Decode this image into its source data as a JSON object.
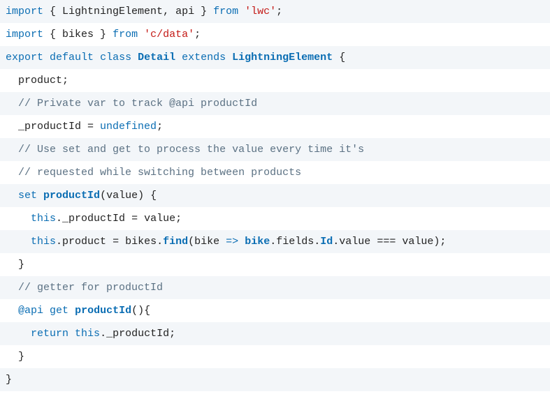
{
  "code": {
    "lines": [
      {
        "indent": 0,
        "tokens": [
          {
            "cls": "tk-keyword",
            "t": "import"
          },
          {
            "cls": "tk-punct",
            "t": " { "
          },
          {
            "cls": "tk-plain",
            "t": "LightningElement"
          },
          {
            "cls": "tk-punct",
            "t": ", "
          },
          {
            "cls": "tk-plain",
            "t": "api"
          },
          {
            "cls": "tk-punct",
            "t": " } "
          },
          {
            "cls": "tk-keyword",
            "t": "from"
          },
          {
            "cls": "tk-punct",
            "t": " "
          },
          {
            "cls": "tk-string",
            "t": "'lwc'"
          },
          {
            "cls": "tk-punct",
            "t": ";"
          }
        ]
      },
      {
        "indent": 0,
        "tokens": [
          {
            "cls": "tk-keyword",
            "t": "import"
          },
          {
            "cls": "tk-punct",
            "t": " { "
          },
          {
            "cls": "tk-plain",
            "t": "bikes"
          },
          {
            "cls": "tk-punct",
            "t": " } "
          },
          {
            "cls": "tk-keyword",
            "t": "from"
          },
          {
            "cls": "tk-punct",
            "t": " "
          },
          {
            "cls": "tk-string",
            "t": "'c/data'"
          },
          {
            "cls": "tk-punct",
            "t": ";"
          }
        ]
      },
      {
        "indent": 0,
        "tokens": [
          {
            "cls": "tk-keyword",
            "t": "export"
          },
          {
            "cls": "tk-punct",
            "t": " "
          },
          {
            "cls": "tk-keyword",
            "t": "default"
          },
          {
            "cls": "tk-punct",
            "t": " "
          },
          {
            "cls": "tk-keyword",
            "t": "class"
          },
          {
            "cls": "tk-punct",
            "t": " "
          },
          {
            "cls": "tk-def",
            "t": "Detail"
          },
          {
            "cls": "tk-punct",
            "t": " "
          },
          {
            "cls": "tk-keyword",
            "t": "extends"
          },
          {
            "cls": "tk-punct",
            "t": " "
          },
          {
            "cls": "tk-def",
            "t": "LightningElement"
          },
          {
            "cls": "tk-punct",
            "t": " {"
          }
        ]
      },
      {
        "indent": 1,
        "tokens": [
          {
            "cls": "tk-plain",
            "t": "product"
          },
          {
            "cls": "tk-punct",
            "t": ";"
          }
        ]
      },
      {
        "indent": 1,
        "tokens": [
          {
            "cls": "tk-comment",
            "t": "// Private var to track @api productId"
          }
        ]
      },
      {
        "indent": 1,
        "tokens": [
          {
            "cls": "tk-plain",
            "t": "_productId"
          },
          {
            "cls": "tk-punct",
            "t": " = "
          },
          {
            "cls": "tk-keyword",
            "t": "undefined"
          },
          {
            "cls": "tk-punct",
            "t": ";"
          }
        ]
      },
      {
        "indent": 1,
        "tokens": [
          {
            "cls": "tk-comment",
            "t": "// Use set and get to process the value every time it's"
          }
        ]
      },
      {
        "indent": 1,
        "tokens": [
          {
            "cls": "tk-comment",
            "t": "// requested while switching between products"
          }
        ]
      },
      {
        "indent": 1,
        "tokens": [
          {
            "cls": "tk-keyword",
            "t": "set"
          },
          {
            "cls": "tk-punct",
            "t": " "
          },
          {
            "cls": "tk-def",
            "t": "productId"
          },
          {
            "cls": "tk-punct",
            "t": "("
          },
          {
            "cls": "tk-plain",
            "t": "value"
          },
          {
            "cls": "tk-punct",
            "t": ") {"
          }
        ]
      },
      {
        "indent": 2,
        "tokens": [
          {
            "cls": "tk-keyword",
            "t": "this"
          },
          {
            "cls": "tk-punct",
            "t": "."
          },
          {
            "cls": "tk-plain",
            "t": "_productId"
          },
          {
            "cls": "tk-punct",
            "t": " = "
          },
          {
            "cls": "tk-plain",
            "t": "value"
          },
          {
            "cls": "tk-punct",
            "t": ";"
          }
        ]
      },
      {
        "indent": 2,
        "tokens": [
          {
            "cls": "tk-keyword",
            "t": "this"
          },
          {
            "cls": "tk-punct",
            "t": "."
          },
          {
            "cls": "tk-plain",
            "t": "product"
          },
          {
            "cls": "tk-punct",
            "t": " = "
          },
          {
            "cls": "tk-plain",
            "t": "bikes"
          },
          {
            "cls": "tk-punct",
            "t": "."
          },
          {
            "cls": "tk-def",
            "t": "find"
          },
          {
            "cls": "tk-punct",
            "t": "("
          },
          {
            "cls": "tk-plain",
            "t": "bike"
          },
          {
            "cls": "tk-punct",
            "t": " "
          },
          {
            "cls": "tk-keyword",
            "t": "=>"
          },
          {
            "cls": "tk-punct",
            "t": " "
          },
          {
            "cls": "tk-def",
            "t": "bike"
          },
          {
            "cls": "tk-punct",
            "t": "."
          },
          {
            "cls": "tk-plain",
            "t": "fields"
          },
          {
            "cls": "tk-punct",
            "t": "."
          },
          {
            "cls": "tk-def",
            "t": "Id"
          },
          {
            "cls": "tk-punct",
            "t": "."
          },
          {
            "cls": "tk-plain",
            "t": "value"
          },
          {
            "cls": "tk-punct",
            "t": " === "
          },
          {
            "cls": "tk-plain",
            "t": "value"
          },
          {
            "cls": "tk-punct",
            "t": ");"
          }
        ]
      },
      {
        "indent": 1,
        "tokens": [
          {
            "cls": "tk-punct",
            "t": "}"
          }
        ]
      },
      {
        "indent": 1,
        "tokens": [
          {
            "cls": "tk-comment",
            "t": "// getter for productId"
          }
        ]
      },
      {
        "indent": 1,
        "tokens": [
          {
            "cls": "tk-keyword",
            "t": "@api"
          },
          {
            "cls": "tk-punct",
            "t": " "
          },
          {
            "cls": "tk-keyword",
            "t": "get"
          },
          {
            "cls": "tk-punct",
            "t": " "
          },
          {
            "cls": "tk-def",
            "t": "productId"
          },
          {
            "cls": "tk-punct",
            "t": "(){"
          }
        ]
      },
      {
        "indent": 2,
        "tokens": [
          {
            "cls": "tk-keyword",
            "t": "return"
          },
          {
            "cls": "tk-punct",
            "t": " "
          },
          {
            "cls": "tk-keyword",
            "t": "this"
          },
          {
            "cls": "tk-punct",
            "t": "."
          },
          {
            "cls": "tk-plain",
            "t": "_productId"
          },
          {
            "cls": "tk-punct",
            "t": ";"
          }
        ]
      },
      {
        "indent": 1,
        "tokens": [
          {
            "cls": "tk-punct",
            "t": "}"
          }
        ]
      },
      {
        "indent": 0,
        "tokens": [
          {
            "cls": "tk-punct",
            "t": "}"
          }
        ]
      }
    ]
  }
}
